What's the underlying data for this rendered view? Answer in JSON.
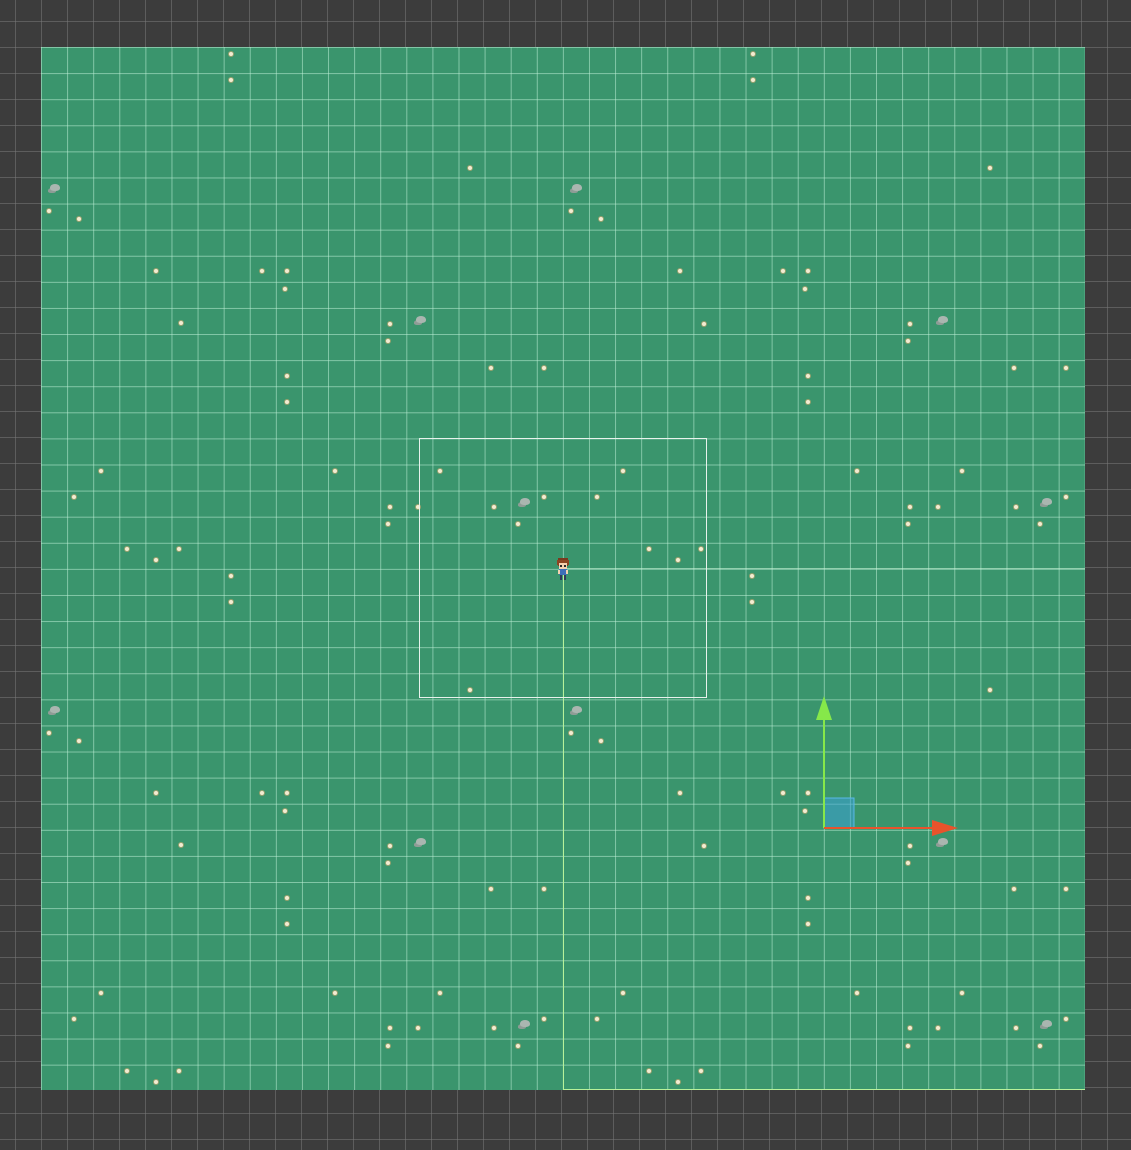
{
  "scene": {
    "background_color": "#3c3c3c",
    "ground_color": "#3a956d",
    "camera_bounds_color": "#e8f2ec",
    "axis_y_color": "#86e84a",
    "axis_x_color": "#e8532c",
    "axis_plane_color": "#3aa0d6"
  },
  "icons": {
    "player": "player-sprite-icon",
    "gizmo": "move-gizmo-icon",
    "flower": "flower-icon",
    "rock": "rock-icon"
  }
}
